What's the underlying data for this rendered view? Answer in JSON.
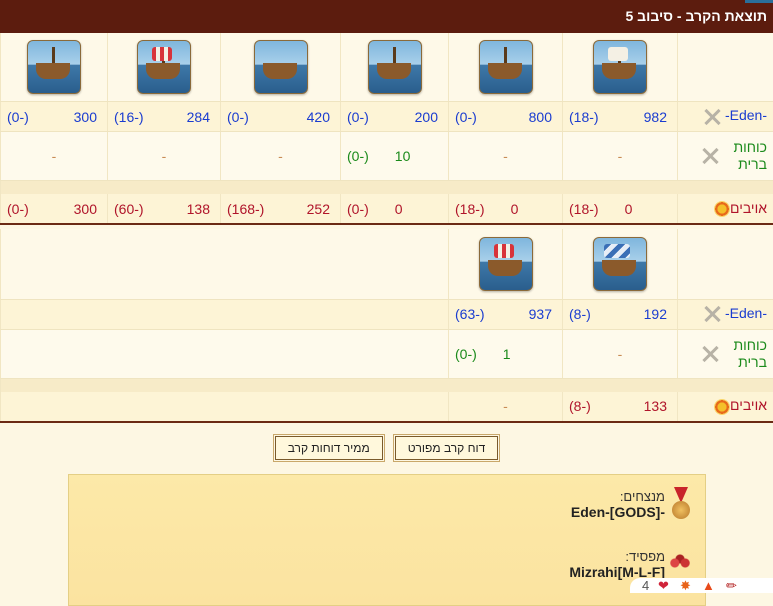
{
  "title": "תוצאת הקרב - סיבוב 5",
  "labels": {
    "own": "-Eden-",
    "allies": "כוחות ברית",
    "enemies": "אויבים"
  },
  "section1": {
    "units": [
      "small-sail-ship-icon",
      "catapult-ship-icon",
      "ballista-ship-icon",
      "cannon-ship-icon",
      "ram-ship-icon",
      "mortar-ship-icon"
    ],
    "own": [
      {
        "v": "982",
        "l": "(18-)"
      },
      {
        "v": "800",
        "l": "(0-)"
      },
      {
        "v": "200",
        "l": "(0-)"
      },
      {
        "v": "420",
        "l": "(0-)"
      },
      {
        "v": "284",
        "l": "(16-)"
      },
      {
        "v": "300",
        "l": "(0-)"
      }
    ],
    "allies": [
      {
        "v": "-",
        "l": ""
      },
      {
        "v": "-",
        "l": ""
      },
      {
        "v": "10",
        "l": "(0-)"
      },
      {
        "v": "-",
        "l": ""
      },
      {
        "v": "-",
        "l": ""
      },
      {
        "v": "-",
        "l": ""
      }
    ],
    "enemies": [
      {
        "v": "0",
        "l": "(18-)"
      },
      {
        "v": "0",
        "l": "(18-)"
      },
      {
        "v": "0",
        "l": "(0-)"
      },
      {
        "v": "252",
        "l": "(168-)"
      },
      {
        "v": "138",
        "l": "(60-)"
      },
      {
        "v": "300",
        "l": "(0-)"
      }
    ]
  },
  "section2": {
    "units": [
      "paddle-ship-icon",
      "fire-ship-icon"
    ],
    "own": [
      {
        "v": "192",
        "l": "(8-)"
      },
      {
        "v": "937",
        "l": "(63-)"
      }
    ],
    "allies": [
      {
        "v": "-",
        "l": ""
      },
      {
        "v": "1",
        "l": "(0-)"
      }
    ],
    "enemies": [
      {
        "v": "133",
        "l": "(8-)"
      },
      {
        "v": "-",
        "l": ""
      }
    ]
  },
  "buttons": {
    "detailed": "דוח קרב מפורט",
    "converter": "ממיר דוחות קרב"
  },
  "result": {
    "winner_label": "מנצחים:",
    "winner": "Eden-[GODS]-",
    "loser_label": "מפסיד:",
    "loser": "Mizrahi[M-L-F]"
  },
  "reactions": {
    "count": "4"
  }
}
